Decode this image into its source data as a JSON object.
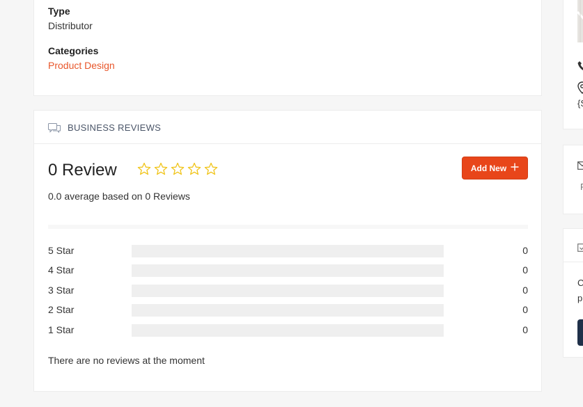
{
  "listing": {
    "type_label": "Type",
    "type_value": "Distributor",
    "categories_label": "Categories",
    "category_link": "Product Design"
  },
  "reviews": {
    "section_title": "BUSINESS REVIEWS",
    "count_text": "0 Review",
    "rating_stars": 0,
    "max_stars": 5,
    "average_text": "0.0 average based on 0 Reviews",
    "add_button_label": "Add New",
    "breakdown": [
      {
        "label": "5 Star",
        "count": "0",
        "fraction": 0
      },
      {
        "label": "4 Star",
        "count": "0",
        "fraction": 0
      },
      {
        "label": "3 Star",
        "count": "0",
        "fraction": 0
      },
      {
        "label": "2 Star",
        "count": "0",
        "fraction": 0
      },
      {
        "label": "1 Star",
        "count": "0",
        "fraction": 0
      }
    ],
    "empty_message": "There are no reviews at the moment"
  },
  "sidebar": {
    "address_fragment": "{S",
    "contact_fragment": "F",
    "claim_line1": "C",
    "claim_line2": "p"
  },
  "colors": {
    "accent": "#e8461a",
    "link": "#e8562a",
    "star": "#f0c419",
    "dark_button": "#1f3049"
  },
  "icons": {
    "header": "reviews-chat-icon",
    "star": "star-outline-icon",
    "plus": "plus-icon",
    "phone": "phone-icon",
    "location": "map-pin-icon",
    "mail": "envelope-icon",
    "claim": "check-envelope-icon"
  }
}
